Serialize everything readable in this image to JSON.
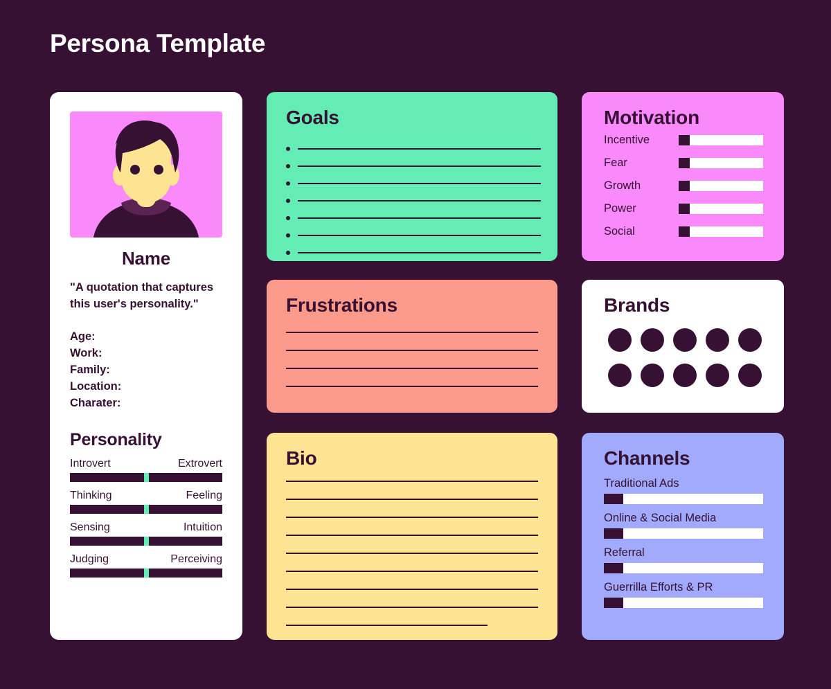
{
  "page": {
    "title": "Persona Template",
    "background_color": "#371133"
  },
  "colors": {
    "background": "#371133",
    "ink": "#371133",
    "white": "#FFFFFF",
    "mint": "#63ECB4",
    "pink": "#FA8AFC",
    "salmon": "#FC9B8B",
    "yellow": "#FCE492",
    "periwinkle": "#A1AAFC",
    "skin": "#FCE492"
  },
  "persona": {
    "avatar_alt": "person-avatar",
    "name": "Name",
    "quote": "\"A quotation that captures this user's personality.\"",
    "fields": [
      {
        "label": "Age:"
      },
      {
        "label": "Work:"
      },
      {
        "label": "Family:"
      },
      {
        "label": "Location:"
      },
      {
        "label": "Charater:"
      }
    ],
    "personality": {
      "title": "Personality",
      "traits": [
        {
          "left": "Introvert",
          "right": "Extrovert",
          "position": 50
        },
        {
          "left": "Thinking",
          "right": "Feeling",
          "position": 50
        },
        {
          "left": "Sensing",
          "right": "Intuition",
          "position": 50
        },
        {
          "left": "Judging",
          "right": "Perceiving",
          "position": 50
        }
      ]
    }
  },
  "goals": {
    "title": "Goals",
    "line_count": 7
  },
  "motivation": {
    "title": "Motivation",
    "items": [
      {
        "label": "Incentive",
        "value": 13
      },
      {
        "label": "Fear",
        "value": 13
      },
      {
        "label": "Growth",
        "value": 13
      },
      {
        "label": "Power",
        "value": 13
      },
      {
        "label": "Social",
        "value": 13
      }
    ]
  },
  "frustrations": {
    "title": "Frustrations",
    "line_count": 4
  },
  "brands": {
    "title": "Brands",
    "rows": 2,
    "columns": 5,
    "dot_count": 10
  },
  "bio": {
    "title": "Bio",
    "line_count": 9,
    "last_line_short": true
  },
  "channels": {
    "title": "Channels",
    "items": [
      {
        "label": "Traditional Ads",
        "value": 12
      },
      {
        "label": "Online & Social Media",
        "value": 12
      },
      {
        "label": "Referral",
        "value": 12
      },
      {
        "label": "Guerrilla Efforts & PR",
        "value": 12
      }
    ]
  }
}
